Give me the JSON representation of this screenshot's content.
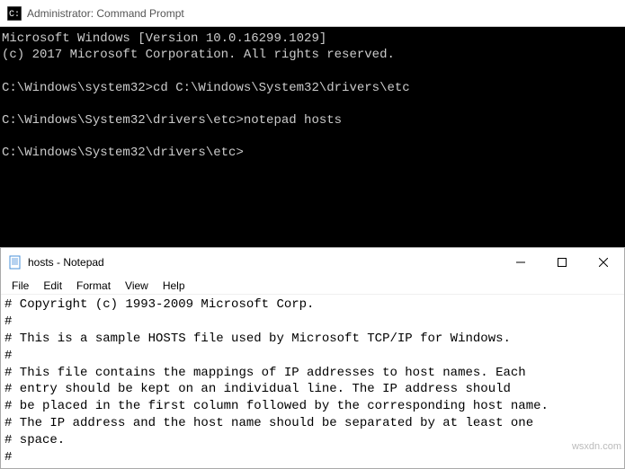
{
  "cmd": {
    "title": "Administrator: Command Prompt",
    "lines": {
      "l1": "Microsoft Windows [Version 10.0.16299.1029]",
      "l2": "(c) 2017 Microsoft Corporation. All rights reserved.",
      "l3": "",
      "l4": "C:\\Windows\\system32>cd C:\\Windows\\System32\\drivers\\etc",
      "l5": "",
      "l6": "C:\\Windows\\System32\\drivers\\etc>notepad hosts",
      "l7": "",
      "l8": "C:\\Windows\\System32\\drivers\\etc>"
    }
  },
  "notepad": {
    "title": "hosts - Notepad",
    "menu": {
      "file": "File",
      "edit": "Edit",
      "format": "Format",
      "view": "View",
      "help": "Help"
    },
    "controls": {
      "minimize": "—",
      "maximize": "☐",
      "close": "✕"
    },
    "lines": {
      "l1": "# Copyright (c) 1993-2009 Microsoft Corp.",
      "l2": "#",
      "l3": "# This is a sample HOSTS file used by Microsoft TCP/IP for Windows.",
      "l4": "#",
      "l5": "# This file contains the mappings of IP addresses to host names. Each",
      "l6": "# entry should be kept on an individual line. The IP address should",
      "l7": "# be placed in the first column followed by the corresponding host name.",
      "l8": "# The IP address and the host name should be separated by at least one",
      "l9": "# space.",
      "l10": "#"
    }
  },
  "watermark": "wsxdn.com"
}
